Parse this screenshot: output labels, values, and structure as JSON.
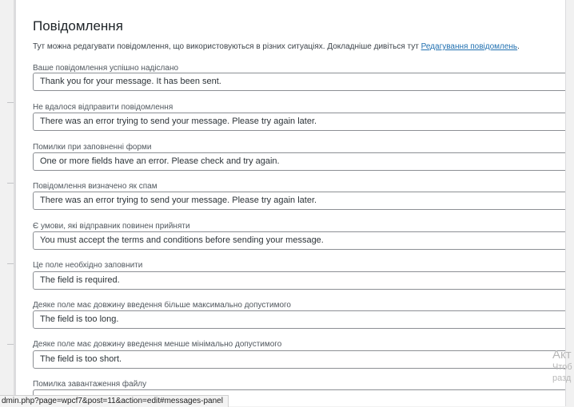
{
  "section": {
    "title": "Повідомлення",
    "description": "Тут можна редагувати повідомлення, що використовуються в різних ситуаціях. Докладніше дивіться тут ",
    "link_text": "Редагування повідомлень",
    "description_end": "."
  },
  "fields": [
    {
      "label": "Ваше повідомлення успішно надіслано",
      "value": "Thank you for your message. It has been sent."
    },
    {
      "label": "Не вдалося відправити повідомлення",
      "value": "There was an error trying to send your message. Please try again later."
    },
    {
      "label": "Помилки при заповненні форми",
      "value": "One or more fields have an error. Please check and try again."
    },
    {
      "label": "Повідомлення визначено як спам",
      "value": "There was an error trying to send your message. Please try again later."
    },
    {
      "label": "Є умови, які відправник повинен прийняти",
      "value": "You must accept the terms and conditions before sending your message."
    },
    {
      "label": "Це поле необхідно заповнити",
      "value": "The field is required."
    },
    {
      "label": "Деяке поле має довжину введення більше максимально допустимого",
      "value": "The field is too long."
    },
    {
      "label": "Деяке поле має довжину введення менше мінімально допустимого",
      "value": "The field is too short."
    },
    {
      "label": "Помилка завантаження файлу",
      "value": ""
    }
  ],
  "status_bar": {
    "url": "dmin.php?page=wpcf7&post=11&action=edit#messages-panel"
  },
  "activation_overlay": {
    "line1": "Акт",
    "line2": "Чтоб",
    "line3": "разд"
  }
}
